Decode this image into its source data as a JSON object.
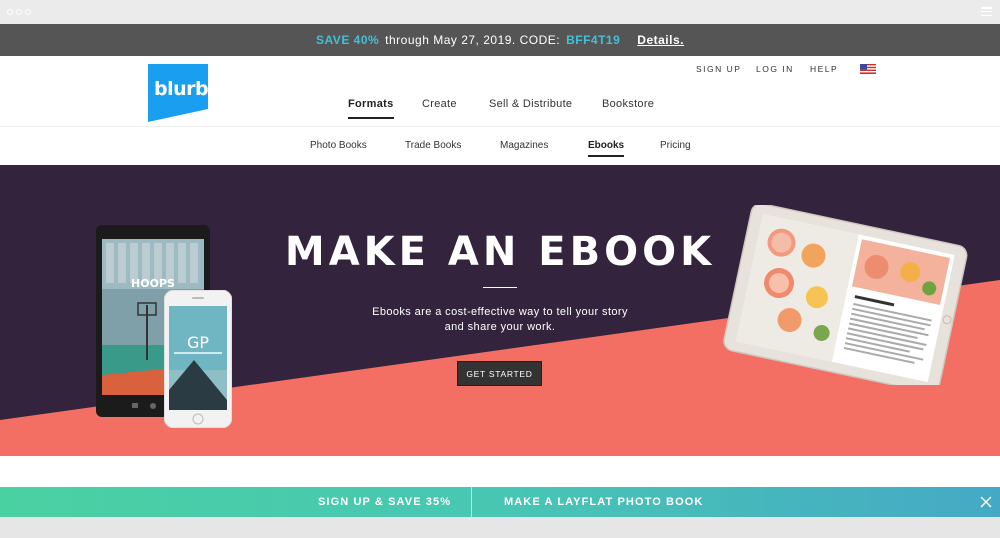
{
  "promo": {
    "save": "SAVE 40%",
    "text": "through May 27, 2019. CODE:",
    "code": "BFF4T19",
    "details": "Details."
  },
  "header": {
    "logo": "blurb",
    "util": {
      "signup": "SIGN UP",
      "login": "LOG IN",
      "help": "HELP",
      "flag": "us-flag-icon"
    },
    "nav": [
      "Formats",
      "Create",
      "Sell & Distribute",
      "Bookstore"
    ],
    "active_nav": "Formats"
  },
  "subnav": {
    "items": [
      "Photo Books",
      "Trade Books",
      "Magazines",
      "Ebooks",
      "Pricing"
    ],
    "active": "Ebooks"
  },
  "hero": {
    "title": "MAKE AN EBOOK",
    "subtitle_line1": "Ebooks are a cost-effective way to tell your story",
    "subtitle_line2": "and share your work.",
    "button": "GET STARTED",
    "tablet_book": "HOOPS",
    "phone_book": "GP",
    "colors": {
      "dark": "#34233d",
      "coral": "#f36f64"
    }
  },
  "bottom_bar": {
    "signup": "SIGN UP & SAVE 35%",
    "layflat": "MAKE A LAYFLAT PHOTO BOOK"
  },
  "colors": {
    "accent": "#44c0d6",
    "brand": "#1a9ff0",
    "gradient_start": "#4ad1a2",
    "gradient_end": "#45a9c6"
  }
}
